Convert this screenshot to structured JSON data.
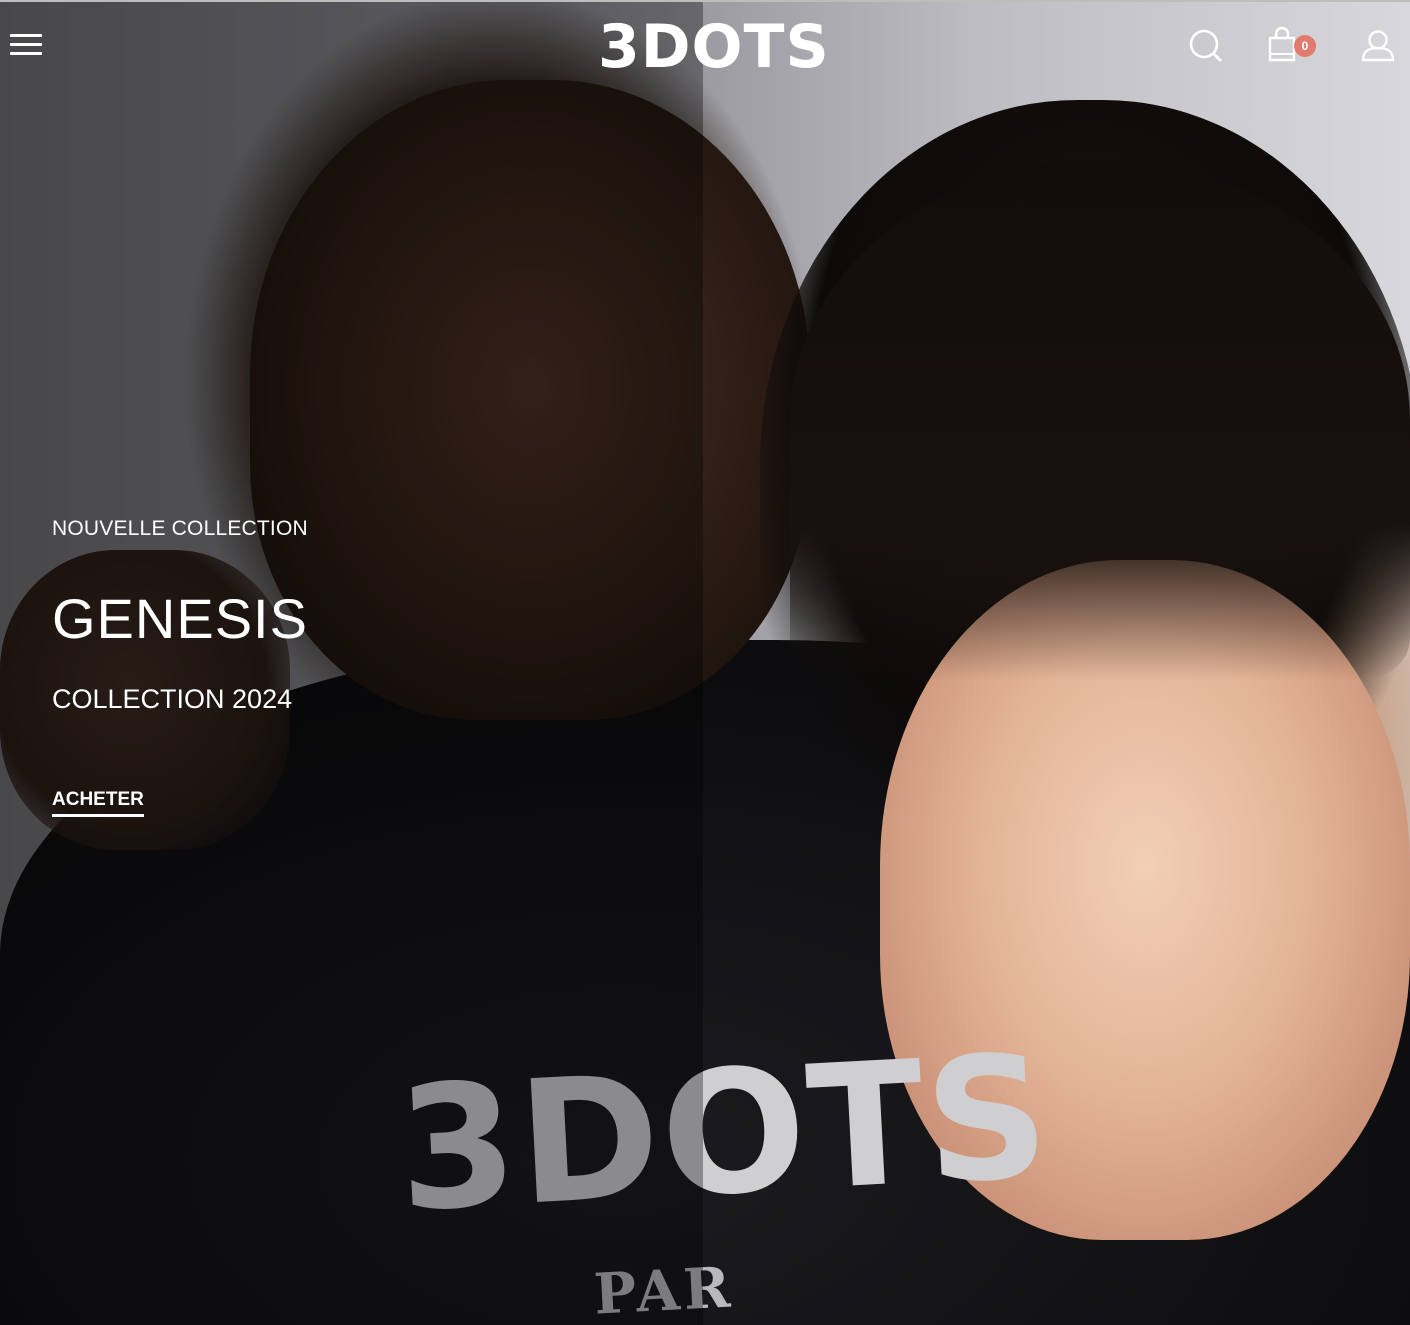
{
  "header": {
    "logo_text": "3DOTS",
    "cart_count": "0",
    "icons": {
      "menu": "hamburger-menu-icon",
      "search": "search-icon",
      "cart": "shopping-bag-icon",
      "account": "user-account-icon"
    },
    "badge_color": "#e27a6f"
  },
  "hero": {
    "eyebrow": "NOUVELLE COLLECTION",
    "title": "GENESIS",
    "subtitle": "COLLECTION 2024",
    "cta_label": "ACHETER",
    "tshirt_print": "3DOTS",
    "tshirt_print_sub": "PAR"
  }
}
